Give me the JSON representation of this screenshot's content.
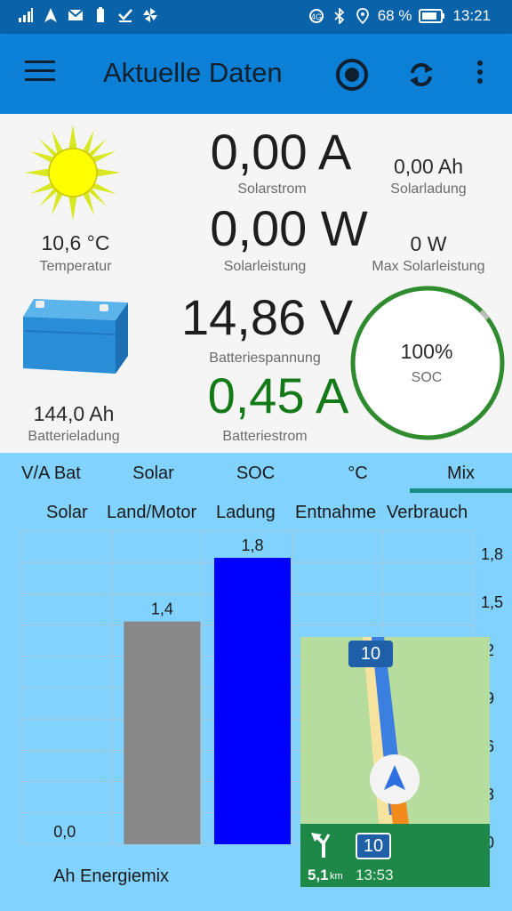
{
  "status_bar": {
    "battery_percent": "68 %",
    "time": "13:21",
    "left_icons": [
      "signal-icon",
      "navigation-icon",
      "mail-icon",
      "battery-alert-icon",
      "check-icon",
      "pinwheel-icon"
    ],
    "right_icons": [
      "data-saver-icon",
      "bluetooth-icon",
      "location-icon",
      "battery-icon"
    ]
  },
  "app_bar": {
    "title": "Aktuelle Daten"
  },
  "solar": {
    "temperature_value": "10,6 °C",
    "temperature_label": "Temperatur",
    "current_value": "0,00 A",
    "current_label": "Solarstrom",
    "charge_value": "0,00 Ah",
    "charge_label": "Solarladung",
    "power_value": "0,00 W",
    "power_label": "Solarleistung",
    "max_power_value": "0 W",
    "max_power_label": "Max Solarleistung"
  },
  "battery": {
    "charge_value": "144,0 Ah",
    "charge_label": "Batterieladung",
    "voltage_value": "14,86 V",
    "voltage_label": "Batteriespannung",
    "current_value": "0,45 A",
    "current_label": "Batteriestrom",
    "soc_value": "100%",
    "soc_label": "SOC",
    "soc_fraction": 1.0
  },
  "tabs": [
    {
      "label": "V/A Bat",
      "active": false
    },
    {
      "label": "Solar",
      "active": false
    },
    {
      "label": "SOC",
      "active": false
    },
    {
      "label": "°C",
      "active": false
    },
    {
      "label": "Mix",
      "active": true
    }
  ],
  "chart_legend": [
    "Solar",
    "Land/Motor",
    "Ladung",
    "Entnahme",
    "Verbrauch"
  ],
  "chart_title": "Ah Energiemix",
  "chart_data": {
    "type": "bar",
    "categories": [
      "Solar",
      "Land/Motor",
      "Ladung",
      "Entnahme",
      "Verbrauch"
    ],
    "values": [
      0.0,
      1.4,
      1.8,
      null,
      null
    ],
    "value_labels": [
      "0,0",
      "1,4",
      "1,8",
      "",
      ""
    ],
    "colors": [
      "#888888",
      "#888888",
      "#0000ff",
      "#888888",
      "#888888"
    ],
    "ylim": [
      0,
      1.8
    ],
    "yticks": [
      "1,8",
      "1,5",
      ",2",
      ",9",
      ",6",
      ",3",
      ",0"
    ],
    "title": "Ah Energiemix",
    "grid": true
  },
  "nav_overlay": {
    "route_shield": "10",
    "distance_value": "5,1",
    "distance_unit": "km",
    "next_shield": "10",
    "eta": "13:53",
    "colors": {
      "map": "#b6dc9e",
      "route": "#3b7fe0",
      "panel": "#1d8848"
    }
  }
}
